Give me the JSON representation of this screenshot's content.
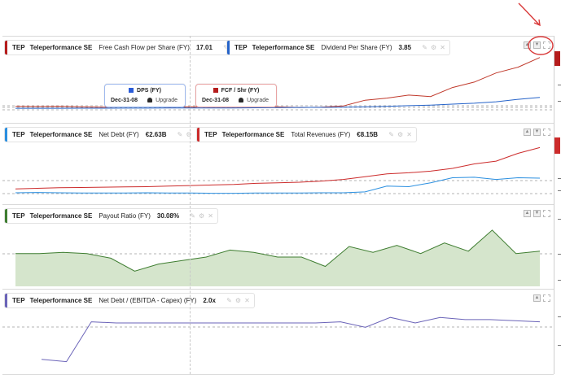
{
  "panes": [
    {
      "legends": [
        {
          "symbol": "TEP",
          "company": "Teleperformance SE",
          "metric": "Free Cash Flow per Share (FY)",
          "value": "17.01",
          "color": "#b51c1c"
        },
        {
          "symbol": "TEP",
          "company": "Teleperformance SE",
          "metric": "Dividend Per Share (FY)",
          "value": "3.85",
          "color": "#2563c9"
        }
      ],
      "tooltips": [
        {
          "label": "DPS (FY)",
          "date": "Dec-31-08",
          "action": "Upgrade",
          "color": "#2a5bd7"
        },
        {
          "label": "FCF / Shr (FY)",
          "date": "Dec-31-08",
          "action": "Upgrade",
          "color": "#b51c1c"
        }
      ]
    },
    {
      "legends": [
        {
          "symbol": "TEP",
          "company": "Teleperformance SE",
          "metric": "Net Debt (FY)",
          "value": "€2.63B",
          "color": "#2a8fe0"
        },
        {
          "symbol": "TEP",
          "company": "Teleperformance SE",
          "metric": "Total Revenues (FY)",
          "value": "€8.15B",
          "color": "#cc2b2b"
        }
      ]
    },
    {
      "legends": [
        {
          "symbol": "TEP",
          "company": "Teleperformance SE",
          "metric": "Payout Ratio (FY)",
          "value": "30.08%",
          "color": "#3e7d30"
        }
      ]
    },
    {
      "legends": [
        {
          "symbol": "TEP",
          "company": "Teleperformance SE",
          "metric": "Net Debt / (EBITDA - Capex) (FY)",
          "value": "2.0x",
          "color": "#6a63b8"
        }
      ]
    }
  ],
  "chart_data": [
    {
      "type": "line",
      "series": [
        {
          "name": "Free Cash Flow per Share (FY)",
          "color": "#c0392b",
          "values": [
            0.9,
            0.8,
            0.9,
            0.7,
            0.6,
            0.7,
            0.8,
            0.6,
            0.7,
            0.6,
            0.6,
            0.6,
            0.7,
            0.5,
            0.6,
            1.0,
            2.9,
            3.6,
            4.6,
            4.1,
            7.1,
            8.9,
            11.9,
            13.8,
            17.01
          ]
        },
        {
          "name": "Dividend Per Share (FY)",
          "color": "#2563c9",
          "values": [
            0.25,
            0.25,
            0.25,
            0.27,
            0.27,
            0.3,
            0.3,
            0.32,
            0.33,
            0.35,
            0.36,
            0.4,
            0.45,
            0.5,
            0.55,
            0.6,
            0.7,
            0.9,
            1.1,
            1.3,
            1.6,
            1.9,
            2.4,
            3.2,
            3.85
          ]
        }
      ]
    },
    {
      "type": "line",
      "series": [
        {
          "name": "Total Revenues (FY)",
          "color": "#cc2b2b",
          "values": [
            0.7,
            0.8,
            0.9,
            0.95,
            1.0,
            1.05,
            1.1,
            1.2,
            1.3,
            1.4,
            1.5,
            1.7,
            1.8,
            1.9,
            2.1,
            2.4,
            2.9,
            3.4,
            3.6,
            3.9,
            4.4,
            5.2,
            5.7,
            7.1,
            8.15
          ]
        },
        {
          "name": "Net Debt (FY)",
          "color": "#2a8fe0",
          "values": [
            0.0,
            0.05,
            0.0,
            -0.05,
            -0.05,
            -0.05,
            0.0,
            -0.05,
            -0.05,
            -0.1,
            -0.1,
            -0.05,
            -0.05,
            -0.05,
            0.0,
            0.0,
            0.15,
            1.2,
            1.1,
            1.8,
            2.7,
            2.8,
            2.4,
            2.7,
            2.63
          ]
        }
      ]
    },
    {
      "type": "area",
      "series": [
        {
          "name": "Payout Ratio (FY)",
          "color": "#3e7d30",
          "values": [
            28,
            28,
            29,
            28,
            24,
            13,
            19,
            22,
            25,
            31,
            29,
            25,
            25,
            17,
            34,
            29,
            35,
            28,
            37,
            30,
            48,
            28,
            30.08
          ]
        }
      ]
    },
    {
      "type": "line",
      "series": [
        {
          "name": "Net Debt / (EBITDA - Capex) (FY)",
          "color": "#6a63b8",
          "values": [
            -1.4,
            -1.6,
            2.0,
            1.9,
            1.9,
            1.9,
            1.9,
            1.9,
            1.9,
            1.9,
            1.9,
            1.9,
            2.0,
            1.5,
            2.4,
            1.9,
            2.4,
            2.2,
            2.2,
            2.1,
            2.0
          ]
        }
      ]
    }
  ]
}
